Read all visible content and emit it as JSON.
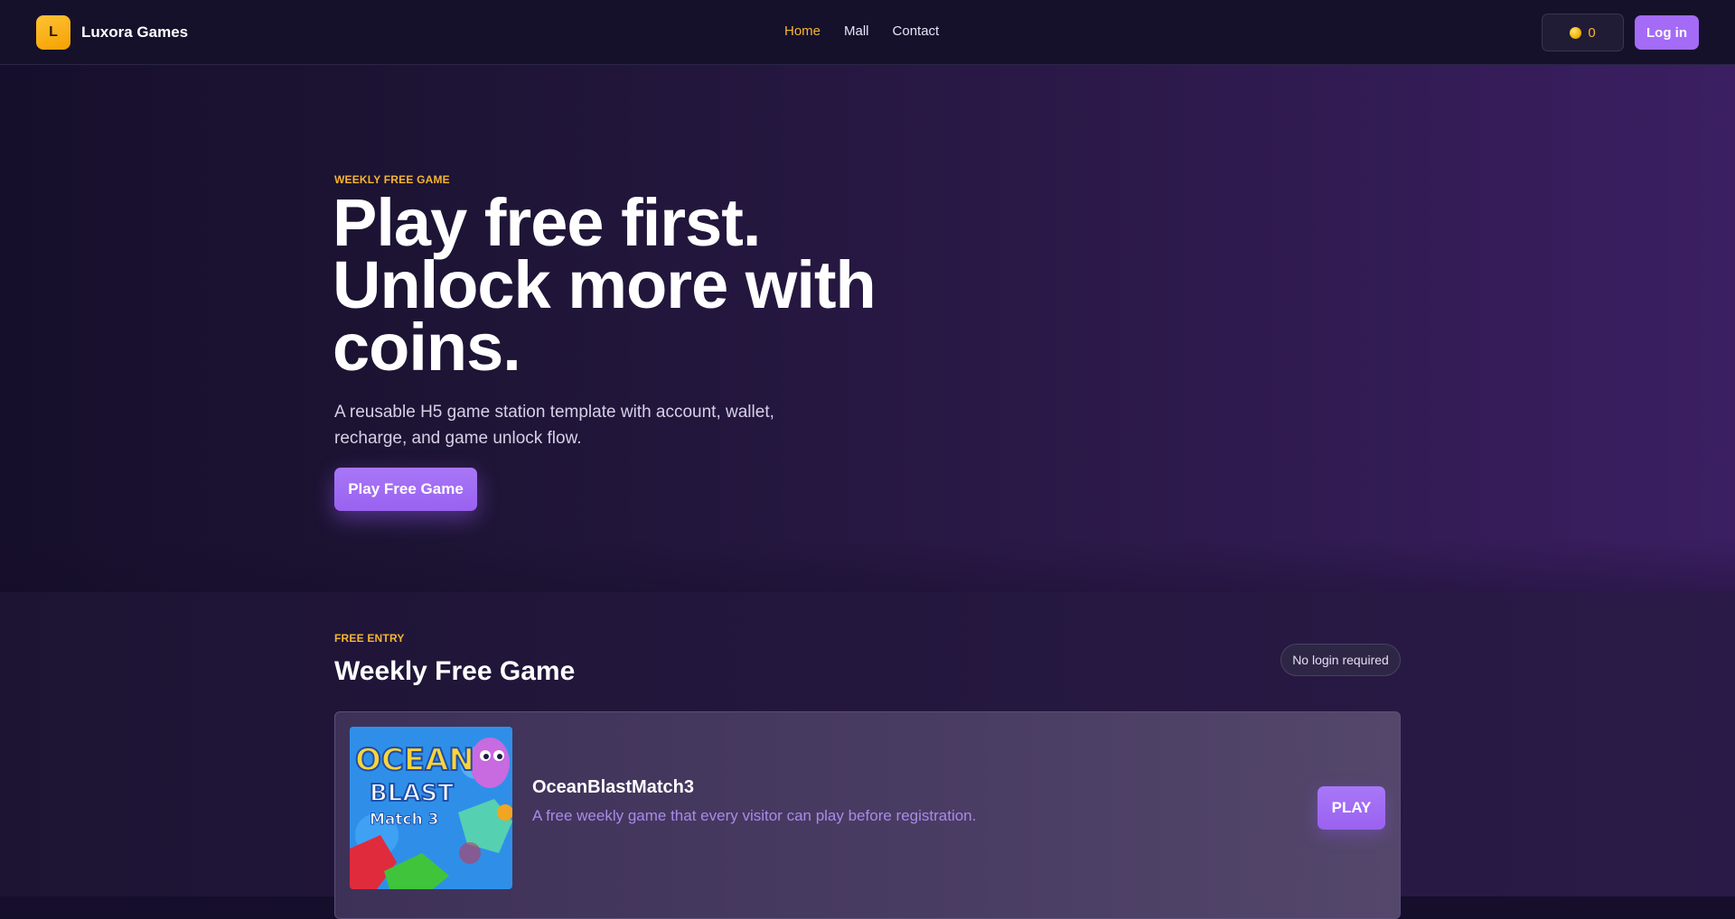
{
  "header": {
    "brand": {
      "logo_letter": "L",
      "name": "Luxora Games"
    },
    "nav": [
      {
        "label": "Home",
        "active": true
      },
      {
        "label": "Mall",
        "active": false
      },
      {
        "label": "Contact",
        "active": false
      }
    ],
    "wallet": {
      "icon": "coin-icon",
      "balance": "0"
    },
    "login_label": "Log in"
  },
  "hero": {
    "eyebrow": "WEEKLY FREE GAME",
    "title_lines": [
      "Play free first.",
      "Unlock more with",
      "coins."
    ],
    "subtitle": "A reusable H5 game station template with account, wallet, recharge, and game unlock flow.",
    "cta_label": "Play Free Game"
  },
  "weekly": {
    "eyebrow": "FREE ENTRY",
    "title": "Weekly Free Game",
    "badge": "No login required",
    "game": {
      "thumbnail_alt": "OceanBlastMatch3 cover art",
      "thumb_lines": [
        "OCEAN",
        "BLAST",
        "Match 3"
      ],
      "name": "OceanBlastMatch3",
      "description": "A free weekly game that every visitor can play before registration.",
      "play_label": "PLAY"
    }
  },
  "colors": {
    "accent": "#a46bf6",
    "highlight": "#f7b531",
    "background": "#160f2c"
  }
}
